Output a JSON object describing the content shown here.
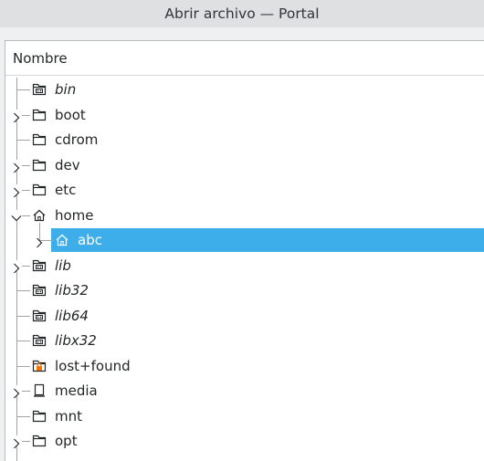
{
  "window": {
    "title": "Abrir archivo — Portal"
  },
  "tree": {
    "column_header": "Nombre",
    "items": [
      {
        "label": "bin",
        "italic": true,
        "icon": "symlink-folder-icon",
        "expandable": false,
        "depth": 0
      },
      {
        "label": "boot",
        "italic": false,
        "icon": "folder-icon",
        "expandable": true,
        "expanded": false,
        "depth": 0
      },
      {
        "label": "cdrom",
        "italic": false,
        "icon": "folder-icon",
        "expandable": false,
        "depth": 0
      },
      {
        "label": "dev",
        "italic": false,
        "icon": "folder-icon",
        "expandable": true,
        "expanded": false,
        "depth": 0
      },
      {
        "label": "etc",
        "italic": false,
        "icon": "folder-icon",
        "expandable": true,
        "expanded": false,
        "depth": 0
      },
      {
        "label": "home",
        "italic": false,
        "icon": "home-icon",
        "expandable": true,
        "expanded": true,
        "depth": 0
      },
      {
        "label": "abc",
        "italic": false,
        "icon": "home-icon",
        "expandable": true,
        "expanded": false,
        "depth": 1,
        "selected": true
      },
      {
        "label": "lib",
        "italic": true,
        "icon": "symlink-folder-icon",
        "expandable": true,
        "expanded": false,
        "depth": 0
      },
      {
        "label": "lib32",
        "italic": true,
        "icon": "symlink-folder-icon",
        "expandable": false,
        "depth": 0
      },
      {
        "label": "lib64",
        "italic": true,
        "icon": "symlink-folder-icon",
        "expandable": false,
        "depth": 0
      },
      {
        "label": "libx32",
        "italic": true,
        "icon": "symlink-folder-icon",
        "expandable": false,
        "depth": 0
      },
      {
        "label": "lost+found",
        "italic": false,
        "icon": "locked-folder-icon",
        "expandable": false,
        "depth": 0
      },
      {
        "label": "media",
        "italic": false,
        "icon": "drive-icon",
        "expandable": true,
        "expanded": false,
        "depth": 0
      },
      {
        "label": "mnt",
        "italic": false,
        "icon": "folder-icon",
        "expandable": false,
        "depth": 0
      },
      {
        "label": "opt",
        "italic": false,
        "icon": "folder-icon",
        "expandable": true,
        "expanded": false,
        "depth": 0
      }
    ]
  },
  "colors": {
    "selection": "#3daee9",
    "lock_accent": "#f67400"
  }
}
